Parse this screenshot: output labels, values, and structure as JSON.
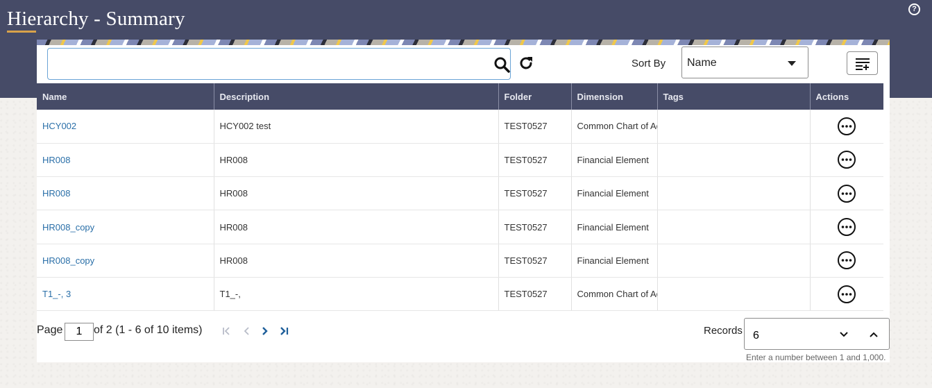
{
  "header": {
    "title": "Hierarchy - Summary",
    "help_icon": "?"
  },
  "toolbar": {
    "search_value": "",
    "sort_label": "Sort By",
    "sort_value": "Name"
  },
  "table": {
    "columns": [
      "Name",
      "Description",
      "Folder",
      "Dimension",
      "Tags",
      "Actions"
    ],
    "rows": [
      {
        "name": "HCY002",
        "description": "HCY002 test",
        "folder": "TEST0527",
        "dimension": "Common Chart of Ac",
        "tags": ""
      },
      {
        "name": "HR008",
        "description": "HR008",
        "folder": "TEST0527",
        "dimension": "Financial Element",
        "tags": ""
      },
      {
        "name": "HR008",
        "description": "HR008",
        "folder": "TEST0527",
        "dimension": "Financial Element",
        "tags": ""
      },
      {
        "name": "HR008_copy",
        "description": "HR008",
        "folder": "TEST0527",
        "dimension": "Financial Element",
        "tags": ""
      },
      {
        "name": "HR008_copy",
        "description": "HR008",
        "folder": "TEST0527",
        "dimension": "Financial Element",
        "tags": ""
      },
      {
        "name": "T1_-, 3",
        "description": "T1_-,",
        "folder": "TEST0527",
        "dimension": "Common Chart of Ac",
        "tags": ""
      }
    ]
  },
  "pager": {
    "page_label": "Page",
    "current_page": "1",
    "summary": "of 2 (1 - 6 of 10 items)"
  },
  "records": {
    "label": "Records",
    "value": "6",
    "hint": "Enter a number between 1 and 1,000."
  },
  "colors": {
    "banner": "#464b67",
    "link": "#2a6fa8",
    "accent": "#d9a34a"
  }
}
